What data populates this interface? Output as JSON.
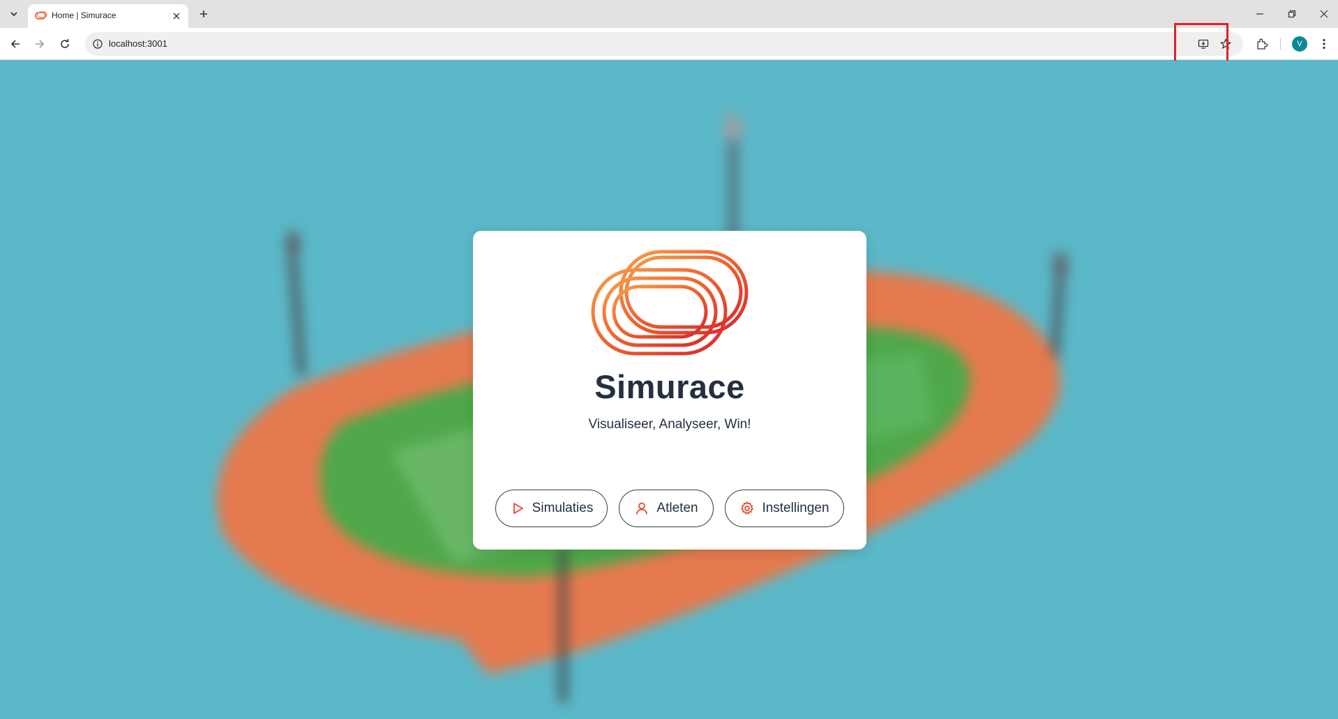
{
  "browser": {
    "tab": {
      "title": "Home | Simurace"
    },
    "address": {
      "url": "localhost:3001"
    },
    "profile": {
      "initial": "V",
      "color": "#0a8a96"
    }
  },
  "app": {
    "title": "Simurace",
    "tagline": "Visualiseer, Analyseer, Win!",
    "buttons": [
      {
        "label": "Simulaties",
        "icon": "play-icon"
      },
      {
        "label": "Atleten",
        "icon": "user-icon"
      },
      {
        "label": "Instellingen",
        "icon": "gear-icon"
      }
    ]
  },
  "colors": {
    "accent": "#e8452a",
    "background": "#5bb8c8",
    "track": "#e57a4e",
    "field": "#4fa84a",
    "text": "#24303f",
    "highlight": "#e0202b"
  }
}
